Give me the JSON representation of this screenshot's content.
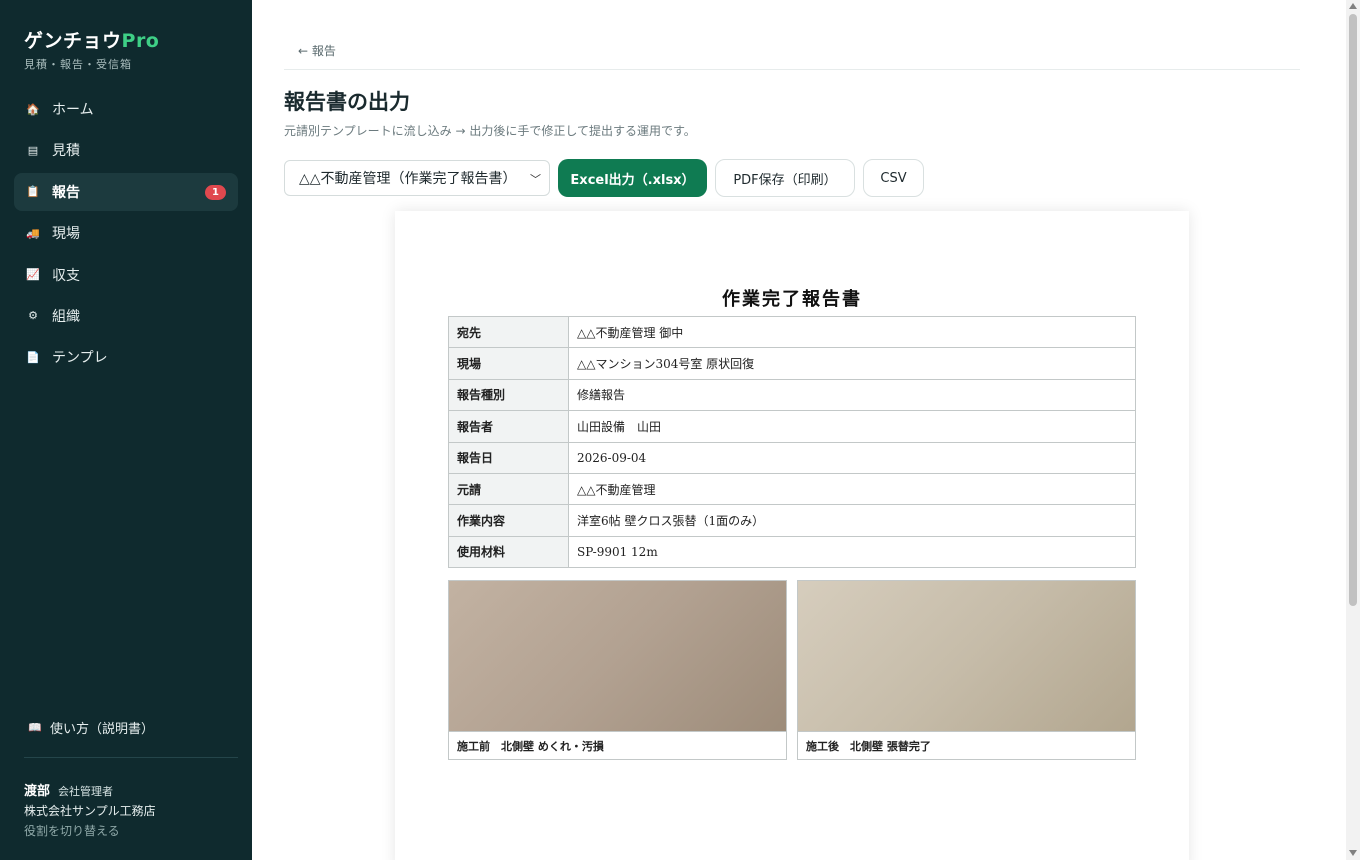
{
  "sidebar": {
    "brand_main": "ゲンチョウ",
    "brand_accent": "Pro",
    "brand_sub": "見積・報告・受信箱",
    "items": [
      {
        "label": "ホーム",
        "icon": "🏠"
      },
      {
        "label": "見積",
        "icon": "▤"
      },
      {
        "label": "報告",
        "icon": "📋",
        "badge": "1"
      },
      {
        "label": "現場",
        "icon": "🚚"
      },
      {
        "label": "収支",
        "icon": "📈"
      },
      {
        "label": "組織",
        "icon": "⚙"
      },
      {
        "label": "テンプレ",
        "icon": "📄"
      }
    ],
    "help_label": "使い方（説明書）",
    "help_icon": "📖",
    "user": {
      "name": "渡部",
      "role": "会社管理者",
      "company": "株式会社サンプル工務店",
      "switch_label": "役割を切り替える"
    }
  },
  "main": {
    "back_label": "← 報告",
    "title": "報告書の出力",
    "description": "元請別テンプレートに流し込み → 出力後に手で修正して提出する運用です。",
    "template_select": "△△不動産管理（作業完了報告書）",
    "excel_button": "Excel出力（.xlsx）",
    "pdf_button": "PDF保存（印刷）",
    "csv_button": "CSV"
  },
  "report": {
    "title": "作業完了報告書",
    "rows": [
      {
        "label": "宛先",
        "value": "△△不動産管理 御中"
      },
      {
        "label": "現場",
        "value": "△△マンション304号室 原状回復"
      },
      {
        "label": "報告種別",
        "value": "修繕報告"
      },
      {
        "label": "報告者",
        "value": "山田設備　山田"
      },
      {
        "label": "報告日",
        "value": "2026-09-04"
      },
      {
        "label": "元請",
        "value": "△△不動産管理"
      },
      {
        "label": "作業内容",
        "value": "洋室6帖 壁クロス張替（1面のみ）"
      },
      {
        "label": "使用材料",
        "value": "SP-9901 12m"
      }
    ],
    "photos": [
      {
        "caption": "施工前　北側壁 めくれ・汚損"
      },
      {
        "caption": "施工後　北側壁 張替完了"
      }
    ]
  }
}
